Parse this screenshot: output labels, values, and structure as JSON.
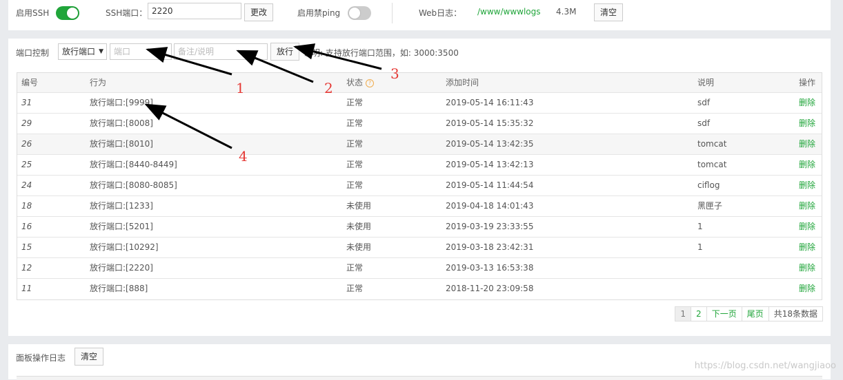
{
  "ssh": {
    "enable_label": "启用SSH",
    "enabled": true,
    "port_label": "SSH端口：",
    "port_value": "2220",
    "change_button": "更改",
    "ping_label": "启用禁ping",
    "ping_enabled": false,
    "weblog_label": "Web日志：",
    "weblog_path": "/www/wwwlogs",
    "weblog_size": "4.3M",
    "clear_button": "清空"
  },
  "port_control": {
    "title": "端口控制",
    "type_select": "放行端口",
    "port_placeholder": "端口",
    "note_placeholder": "备注/说明",
    "allow_button": "放行",
    "hint": "说明: 支持放行端口范围，如: 3000:3500"
  },
  "table": {
    "headers": [
      "编号",
      "行为",
      "状态",
      "添加时间",
      "说明",
      "操作"
    ],
    "rows": [
      {
        "id": "31",
        "action": "放行端口:[9999]",
        "status": "正常",
        "time": "2019-05-14 16:11:43",
        "note": "sdf",
        "op": "删除"
      },
      {
        "id": "29",
        "action": "放行端口:[8008]",
        "status": "正常",
        "time": "2019-05-14 15:35:32",
        "note": "sdf",
        "op": "删除"
      },
      {
        "id": "26",
        "action": "放行端口:[8010]",
        "status": "正常",
        "time": "2019-05-14 13:42:35",
        "note": "tomcat",
        "op": "删除"
      },
      {
        "id": "25",
        "action": "放行端口:[8440-8449]",
        "status": "正常",
        "time": "2019-05-14 13:42:13",
        "note": "tomcat",
        "op": "删除"
      },
      {
        "id": "24",
        "action": "放行端口:[8080-8085]",
        "status": "正常",
        "time": "2019-05-14 11:44:54",
        "note": "ciflog",
        "op": "删除"
      },
      {
        "id": "18",
        "action": "放行端口:[1233]",
        "status": "未使用",
        "time": "2019-04-18 14:01:43",
        "note": "黑匣子",
        "op": "删除"
      },
      {
        "id": "16",
        "action": "放行端口:[5201]",
        "status": "未使用",
        "time": "2019-03-19 23:33:55",
        "note": "1",
        "op": "删除"
      },
      {
        "id": "15",
        "action": "放行端口:[10292]",
        "status": "未使用",
        "time": "2019-03-18 23:42:31",
        "note": "1",
        "op": "删除"
      },
      {
        "id": "12",
        "action": "放行端口:[2220]",
        "status": "正常",
        "time": "2019-03-13 16:53:38",
        "note": "",
        "op": "删除"
      },
      {
        "id": "11",
        "action": "放行端口:[888]",
        "status": "正常",
        "time": "2018-11-20 23:09:58",
        "note": "",
        "op": "删除"
      }
    ]
  },
  "pagination": {
    "pages": [
      "1",
      "2"
    ],
    "current": "1",
    "next": "下一页",
    "last": "尾页",
    "total": "共18条数据"
  },
  "panel_log": {
    "title": "面板操作日志",
    "clear_button": "清空"
  },
  "annotations": [
    "1",
    "2",
    "3",
    "4"
  ],
  "watermark": "https://blog.csdn.net/wangjiaoo",
  "colors": {
    "accent": "#20a53a",
    "annotation": "#e53935",
    "arrow": "#000000"
  }
}
